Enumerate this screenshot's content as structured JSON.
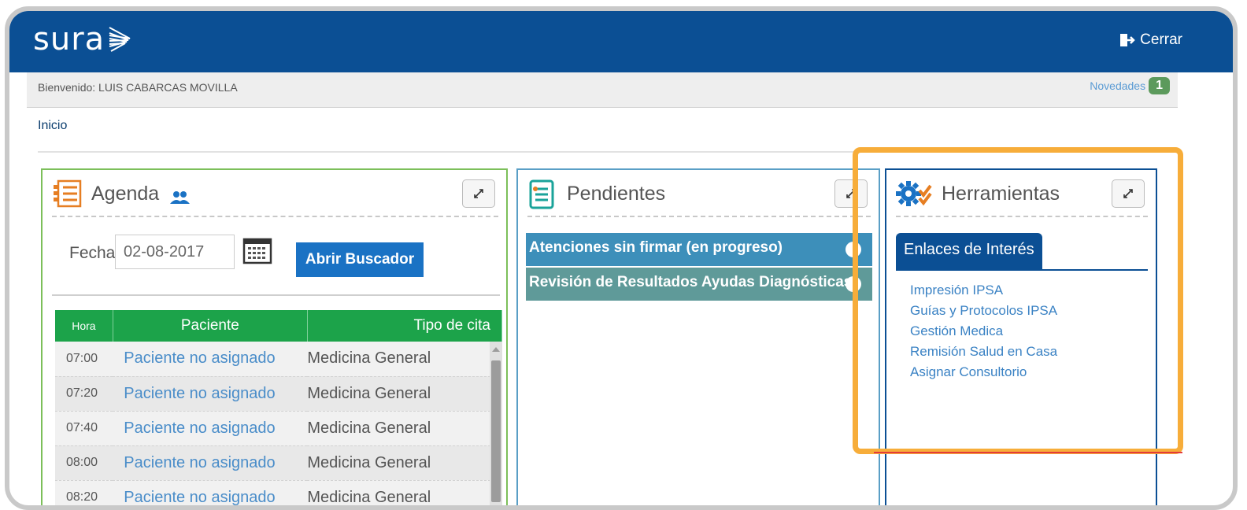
{
  "header": {
    "logo_text": "sura",
    "logout_label": "Cerrar"
  },
  "welcome_bar": {
    "welcome_text": "Bienvenido: LUIS CABARCAS MOVILLA",
    "novedades_label": "Novedades",
    "novedades_count": "1"
  },
  "breadcrumb": "Inicio",
  "agenda": {
    "title": "Agenda",
    "fecha_label": "Fecha",
    "fecha_value": "02-08-2017",
    "search_button": "Abrir Buscador",
    "columns": [
      "Hora",
      "Paciente",
      "Tipo de cita"
    ],
    "rows": [
      {
        "hora": "07:00",
        "paciente": "Paciente no asignado",
        "tipo": "Medicina General"
      },
      {
        "hora": "07:20",
        "paciente": "Paciente no asignado",
        "tipo": "Medicina General"
      },
      {
        "hora": "07:40",
        "paciente": "Paciente no asignado",
        "tipo": "Medicina General"
      },
      {
        "hora": "08:00",
        "paciente": "Paciente no asignado",
        "tipo": "Medicina General"
      },
      {
        "hora": "08:20",
        "paciente": "Paciente no asignado",
        "tipo": "Medicina General"
      }
    ]
  },
  "pendientes": {
    "title": "Pendientes",
    "items": [
      "Atenciones sin firmar (en progreso)",
      "Revisión de Resultados Ayudas Diagnósticas"
    ]
  },
  "herramientas": {
    "title": "Herramientas",
    "tab_label": "Enlaces de Interés",
    "links": [
      "Impresión IPSA",
      "Guías y Protocolos IPSA",
      "Gestión Medica",
      "Remisión Salud en Casa",
      "Asignar Consultorio"
    ]
  },
  "colors": {
    "header_blue": "#0b4f94",
    "agenda_green": "#1ca34a",
    "highlight_orange": "#f7ad3a"
  }
}
